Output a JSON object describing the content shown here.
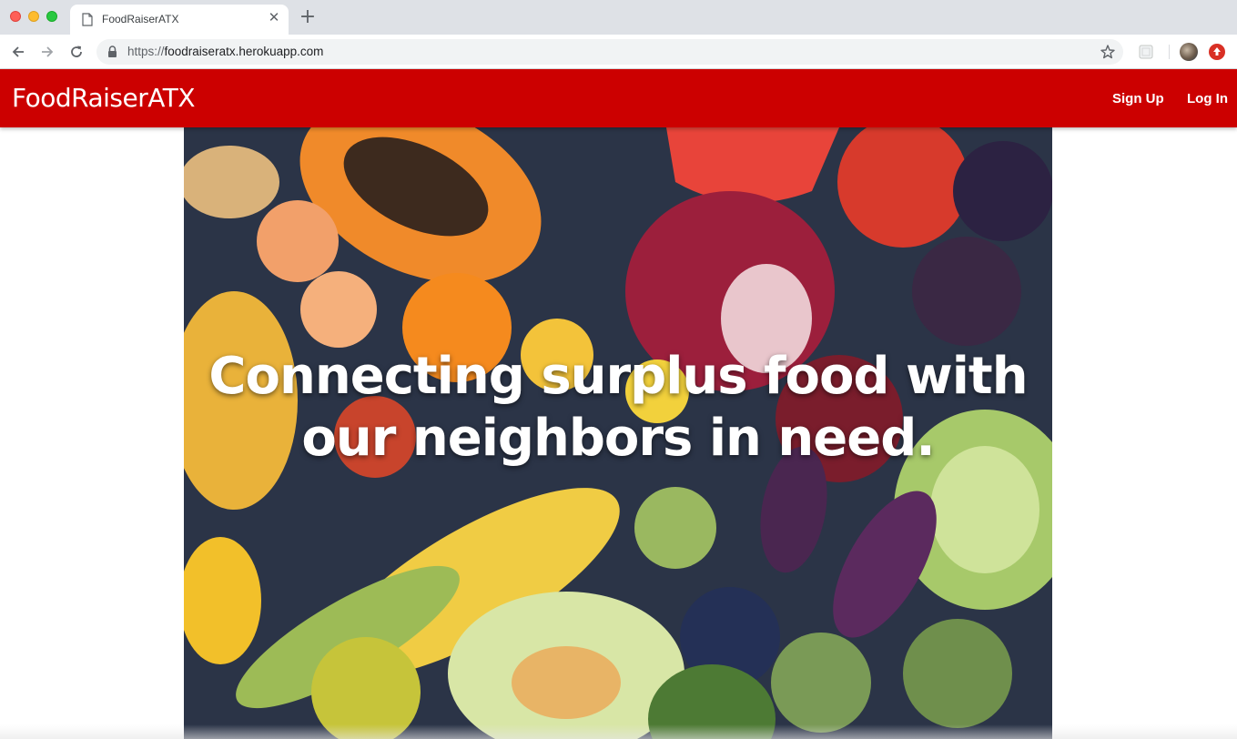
{
  "browser": {
    "tab_title": "FoodRaiserATX",
    "url_scheme": "https://",
    "url_host": "foodraiseratx.herokuapp.com",
    "icons": [
      "back-arrow-icon",
      "forward-arrow-icon",
      "reload-icon",
      "lock-icon",
      "star-icon",
      "extension-icon",
      "avatar",
      "update-icon"
    ]
  },
  "navbar": {
    "brand": "FoodRaiserATX",
    "signup_label": "Sign Up",
    "login_label": "Log In",
    "background_color": "#cc0000"
  },
  "hero": {
    "headline": "Connecting surplus food with our neighbors in need.",
    "image": "fresh-produce-photo"
  }
}
